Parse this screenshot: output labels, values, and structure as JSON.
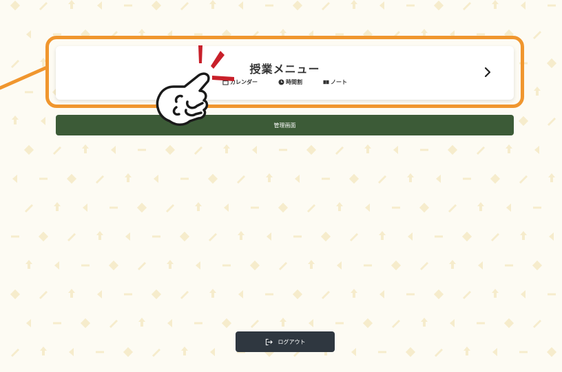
{
  "lesson_menu": {
    "title": "授業メニュー",
    "links": [
      {
        "label": "カレンダー",
        "icon": "calendar-icon"
      },
      {
        "label": "時間割",
        "icon": "clock-icon"
      },
      {
        "label": "ノート",
        "icon": "notebook-icon"
      }
    ]
  },
  "admin": {
    "label": "管理画面"
  },
  "logout": {
    "label": "ログアウト",
    "icon": "logout-icon"
  },
  "colors": {
    "background": "#fdfbf3",
    "pattern": "#f3e7bf",
    "highlight": "#f0962e",
    "admin_button": "#3c5b37",
    "logout_button": "#2f3740",
    "pointer_accent": "#c8202a"
  }
}
